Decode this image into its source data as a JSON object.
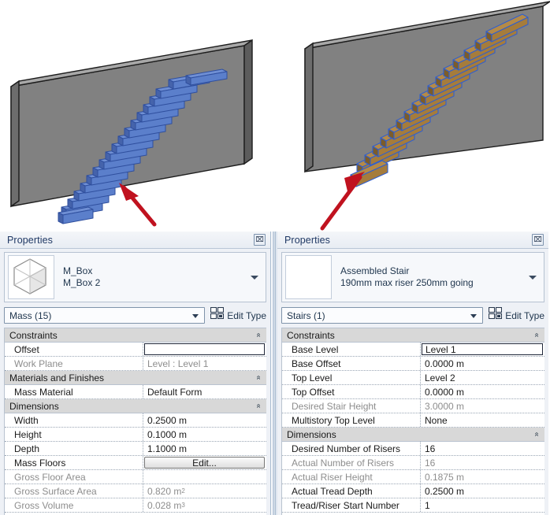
{
  "viewport": {
    "left_model": {
      "name": "mass-stair-model",
      "wall_color": "#818181",
      "tread_color": "#5b7fcb",
      "tread_outline": "#2f4f9e",
      "arrow_color": "#c0121f",
      "tread_count": 16
    },
    "right_model": {
      "name": "assembled-stair-model",
      "wall_color": "#818181",
      "tread_color": "#a57c3c",
      "tread_outline": "#2f5fd0",
      "arrow_color": "#c0121f",
      "tread_count": 16
    }
  },
  "left_panel": {
    "title": "Properties",
    "close_label": "⌧",
    "type_name": "M_Box",
    "type_variant": "M_Box 2",
    "selector_value": "Mass (15)",
    "edit_type_label": "Edit Type",
    "groups": [
      {
        "name": "Constraints",
        "collapse": "»",
        "rows": [
          {
            "label": "Offset",
            "value": "",
            "dim": false,
            "style": "edit"
          },
          {
            "label": "Work Plane",
            "value": "Level : Level 1",
            "dim": true,
            "style": "text"
          }
        ]
      },
      {
        "name": "Materials and Finishes",
        "collapse": "»",
        "rows": [
          {
            "label": "Mass Material",
            "value": "Default Form",
            "dim": false,
            "style": "text"
          }
        ]
      },
      {
        "name": "Dimensions",
        "collapse": "»",
        "rows": [
          {
            "label": "Width",
            "value": "0.2500 m",
            "dim": false,
            "style": "text"
          },
          {
            "label": "Height",
            "value": "0.1000 m",
            "dim": false,
            "style": "text"
          },
          {
            "label": "Depth",
            "value": "1.1000 m",
            "dim": false,
            "style": "text"
          },
          {
            "label": "Mass Floors",
            "value": "Edit...",
            "dim": false,
            "style": "button"
          },
          {
            "label": "Gross Floor Area",
            "value": "",
            "dim": true,
            "style": "text"
          },
          {
            "label": "Gross Surface Area",
            "value": "0.820 m²",
            "dim": true,
            "style": "text"
          },
          {
            "label": "Gross Volume",
            "value": "0.028 m³",
            "dim": true,
            "style": "text"
          }
        ]
      }
    ]
  },
  "right_panel": {
    "title": "Properties",
    "close_label": "⌧",
    "type_name": "Assembled Stair",
    "type_variant": "190mm max riser 250mm going",
    "selector_value": "Stairs (1)",
    "edit_type_label": "Edit Type",
    "groups": [
      {
        "name": "Constraints",
        "collapse": "»",
        "rows": [
          {
            "label": "Base Level",
            "value": "Level 1",
            "dim": false,
            "style": "edit"
          },
          {
            "label": "Base Offset",
            "value": "0.0000 m",
            "dim": false,
            "style": "text"
          },
          {
            "label": "Top Level",
            "value": "Level 2",
            "dim": false,
            "style": "text"
          },
          {
            "label": "Top Offset",
            "value": "0.0000 m",
            "dim": false,
            "style": "text"
          },
          {
            "label": "Desired Stair Height",
            "value": "3.0000 m",
            "dim": true,
            "style": "text"
          },
          {
            "label": "Multistory Top Level",
            "value": "None",
            "dim": false,
            "style": "text"
          }
        ]
      },
      {
        "name": "Dimensions",
        "collapse": "»",
        "rows": [
          {
            "label": "Desired Number of Risers",
            "value": "16",
            "dim": false,
            "style": "text"
          },
          {
            "label": "Actual Number of Risers",
            "value": "16",
            "dim": true,
            "style": "text"
          },
          {
            "label": "Actual Riser Height",
            "value": "0.1875 m",
            "dim": true,
            "style": "text"
          },
          {
            "label": "Actual Tread Depth",
            "value": "0.2500 m",
            "dim": false,
            "style": "text"
          },
          {
            "label": "Tread/Riser Start Number",
            "value": "1",
            "dim": false,
            "style": "text"
          }
        ]
      }
    ]
  }
}
